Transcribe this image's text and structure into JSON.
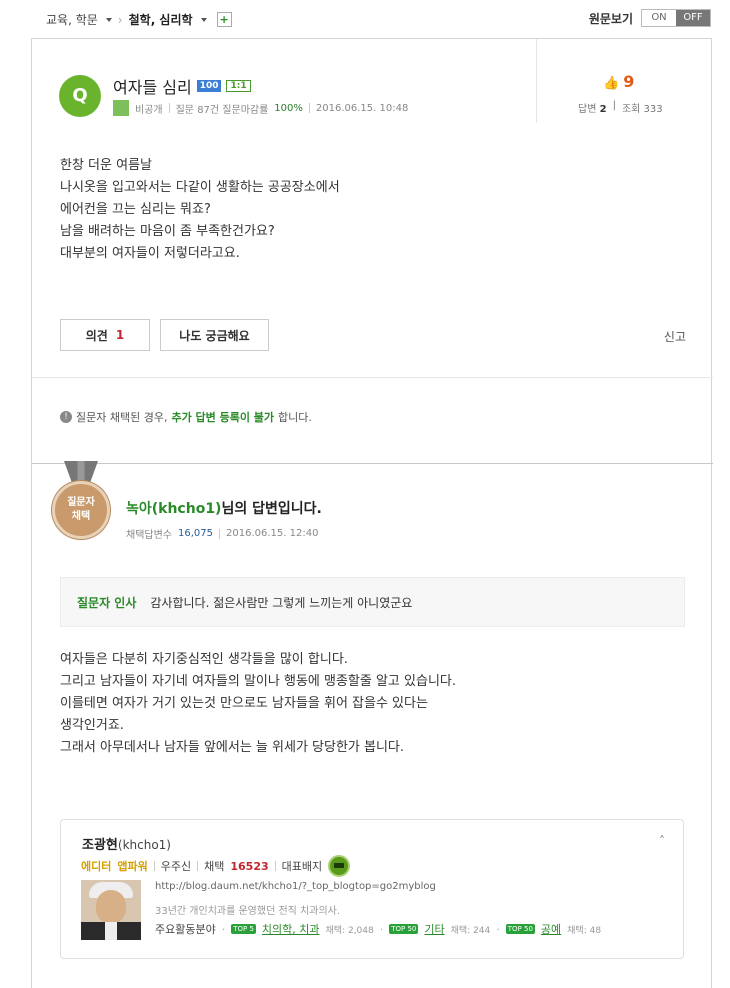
{
  "breadcrumb": {
    "category": "교육, 학문",
    "current": "철학, 심리학",
    "add": "+"
  },
  "original_view": {
    "label": "원문보기",
    "on": "ON",
    "off": "OFF"
  },
  "question": {
    "icon": "Q",
    "title": "여자들 심리",
    "badge_level": "100",
    "badge_type": "1:1",
    "author": "비공개",
    "question_stats": "질문 87건 질문마감률",
    "close_rate": "100%",
    "date": "2016.06.15. 10:48",
    "likes": "9",
    "answers_label": "답변",
    "answers": "2",
    "views_label": "조회",
    "views": "333",
    "body": [
      "한창 더운 여름날",
      "나시옷을 입고와서는 다같이 생활하는 공공장소에서",
      "에어컨을 끄는 심리는 뭐죠?",
      "남을 배려하는 마음이 좀 부족한건가요?",
      "대부분의 여자들이 저렇더라고요."
    ],
    "opinion_label": "의견",
    "opinion_count": "1",
    "curious_label": "나도 궁금해요",
    "report_label": "신고"
  },
  "notice": {
    "prefix": "질문자 채택된 경우, ",
    "highlight": "추가 답변 등록이 불가",
    "suffix": "합니다."
  },
  "answer": {
    "medal_line1": "질문자",
    "medal_line2": "채택",
    "author_name": "녹아(khcho1)",
    "title_suffix": "님의 답변입니다.",
    "adopt_label": "채택답변수",
    "adopt_count": "16,075",
    "date": "2016.06.15. 12:40",
    "greeting_label": "질문자 인사",
    "greeting_text": "감사합니다. 젊은사람만 그렇게 느끼는게 아니였군요",
    "body": [
      "여자들은 다분히 자기중심적인 생각들을 많이 합니다.",
      "그리고 남자들이 자기네 여자들의 말이나 행동에 맹종할줄 알고 있습니다.",
      "이를테면 여자가 거기 있는것 만으로도 남자들을 휘어 잡을수 있다는",
      "생각인거죠.",
      "그래서 아무데서나 남자들 앞에서는 늘 위세가 당당한가 봅니다."
    ]
  },
  "profile": {
    "name": "조광현",
    "id": "(khcho1)",
    "grade": "에디터",
    "power": "앱파워",
    "level": "우주신",
    "adopt_label": "채택",
    "adopt_count": "16523",
    "badge_label": "대표배지",
    "url": "http://blog.daum.net/khcho1/?_top_blogtop=go2myblog",
    "intro": "33년간 개인치과를 운영했던 전직 치과의사.",
    "fields_label": "주요활동분야",
    "fields": [
      {
        "tag": "TOP 5",
        "name": "치의학, 치과",
        "count": "채택: 2,048"
      },
      {
        "tag": "TOP 50",
        "name": "기타",
        "count": "채택: 244"
      },
      {
        "tag": "TOP 50",
        "name": "공예",
        "count": "채택: 48"
      }
    ]
  }
}
